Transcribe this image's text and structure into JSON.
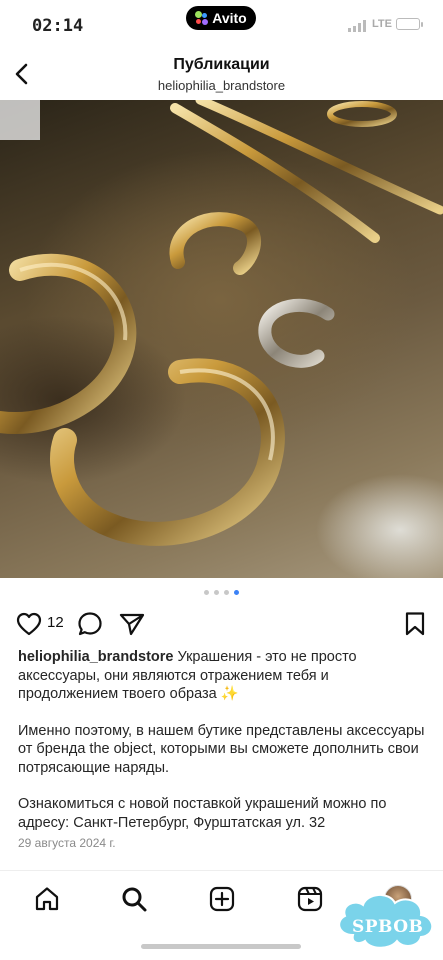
{
  "status": {
    "time": "02:14",
    "app_badge": "Avito",
    "network": "LTE"
  },
  "header": {
    "title": "Публикации",
    "subtitle": "heliophilia_brandstore"
  },
  "post": {
    "likes": "12",
    "carousel": {
      "count": 4,
      "active": 3
    },
    "caption": {
      "username": "heliophilia_brandstore",
      "text1": " Украшения - это не просто аксессуары, они являются отражением тебя и продолжением твоего образа ✨",
      "text2": "Именно поэтому, в нашем бутике представлены аксессуары от бренда the object, которыми вы сможете дополнить свои потрясающие наряды.",
      "text3": "Ознакомиться с новой поставкой украшений  можно по адресу: Санкт-Петербург, Фурштатская ул. 32"
    },
    "date": "29 августа 2024 г."
  },
  "icons": {
    "back": "chevron-left-icon",
    "like": "heart-icon",
    "comment": "comment-icon",
    "share": "send-icon",
    "save": "bookmark-icon",
    "sound": "speaker-icon"
  },
  "tabs": [
    "home",
    "search",
    "create",
    "reels",
    "profile"
  ],
  "watermark": "SPBOB",
  "colors": {
    "accent_dot": "#3b82f6",
    "watermark": "#7ad3ea"
  }
}
